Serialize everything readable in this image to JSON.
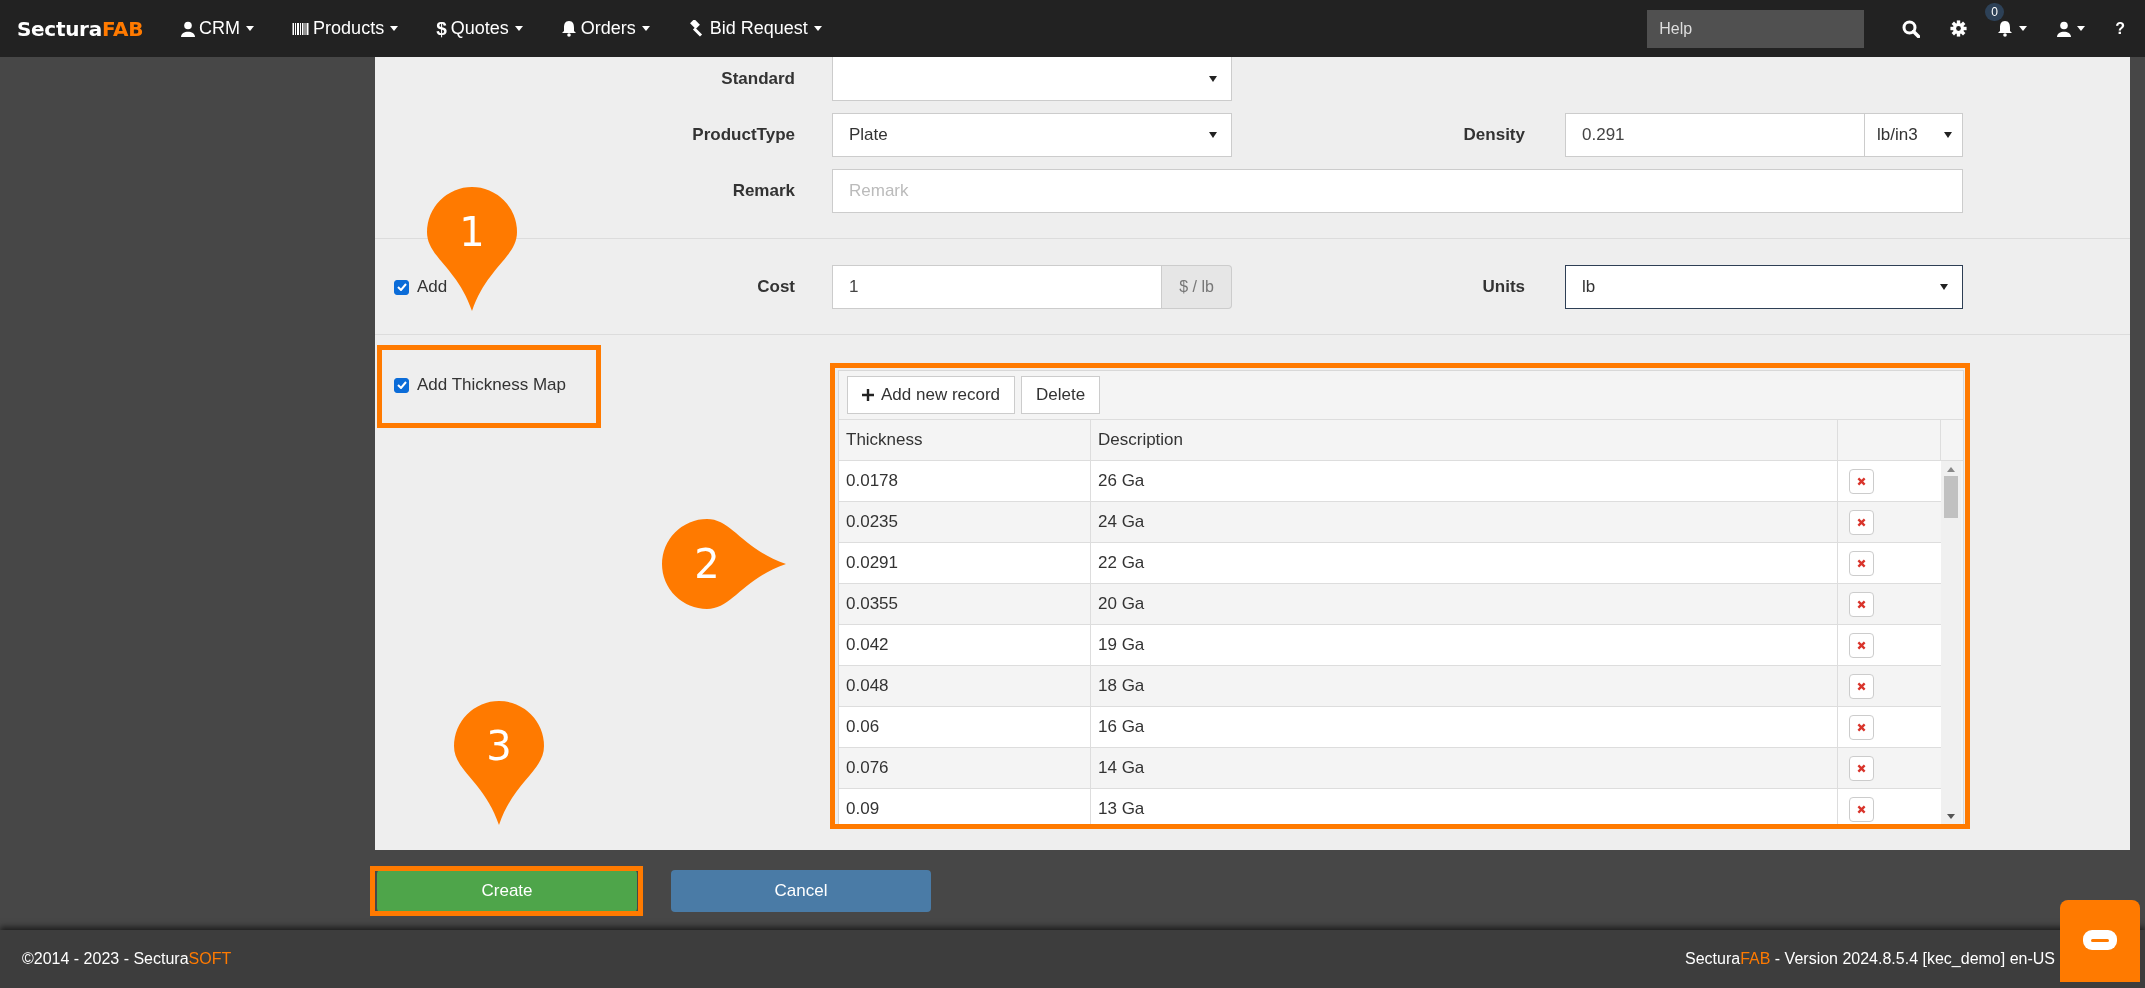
{
  "navbar": {
    "brand": {
      "main": "Sectura",
      "accent": "FAB"
    },
    "menus": [
      {
        "label": "CRM"
      },
      {
        "label": "Products"
      },
      {
        "label": "Quotes",
        "glyph": "$"
      },
      {
        "label": "Orders"
      },
      {
        "label": "Bid Request"
      }
    ],
    "help_field": {
      "placeholder": "Help"
    },
    "notification_count": "0",
    "help_glyph": "?"
  },
  "form": {
    "fields": [
      {
        "label": "Standard",
        "kind": "select"
      },
      {
        "label": "ProductType",
        "kind": "select",
        "value": "Plate"
      },
      {
        "label": "Remark",
        "kind": "text",
        "placeholder": "Remark"
      }
    ],
    "density": {
      "label": "Density",
      "value": "0.291",
      "unit": "lb/in3"
    },
    "add_cost": {
      "label": "Add",
      "checked": true
    },
    "cost": {
      "label": "Cost",
      "value": "1",
      "addon": "$ / lb"
    },
    "units": {
      "label": "Units",
      "value": "lb",
      "focused": true
    },
    "add_thickness_map": {
      "label": "Add Thickness Map",
      "checked": true
    }
  },
  "thickness_grid": {
    "toolbar": [
      {
        "label": "Add new record",
        "kind": "add"
      },
      {
        "label": "Delete",
        "kind": "plain"
      }
    ],
    "columns": [
      "Thickness",
      "Description"
    ],
    "rows": [
      {
        "thickness": "0.0178",
        "description": "26 Ga"
      },
      {
        "thickness": "0.0235",
        "description": "24 Ga"
      },
      {
        "thickness": "0.0291",
        "description": "22 Ga"
      },
      {
        "thickness": "0.0355",
        "description": "20 Ga"
      },
      {
        "thickness": "0.042",
        "description": "19 Ga"
      },
      {
        "thickness": "0.048",
        "description": "18 Ga"
      },
      {
        "thickness": "0.06",
        "description": "16 Ga"
      },
      {
        "thickness": "0.076",
        "description": "14 Ga"
      },
      {
        "thickness": "0.09",
        "description": "13 Ga"
      }
    ]
  },
  "actions": [
    {
      "label": "Create",
      "kind": "primary"
    },
    {
      "label": "Cancel",
      "kind": "secondary"
    }
  ],
  "footer": {
    "copyright": {
      "text": "©2014 - 2023 - Sectura",
      "accent": "SOFT"
    },
    "version": {
      "brand": "Sectura",
      "accent": "FAB",
      "text": " - Version 2024.8.5.4 [kec_demo] en-US"
    }
  },
  "annotations": [
    {
      "number": "1"
    },
    {
      "number": "2"
    },
    {
      "number": "3"
    }
  ]
}
